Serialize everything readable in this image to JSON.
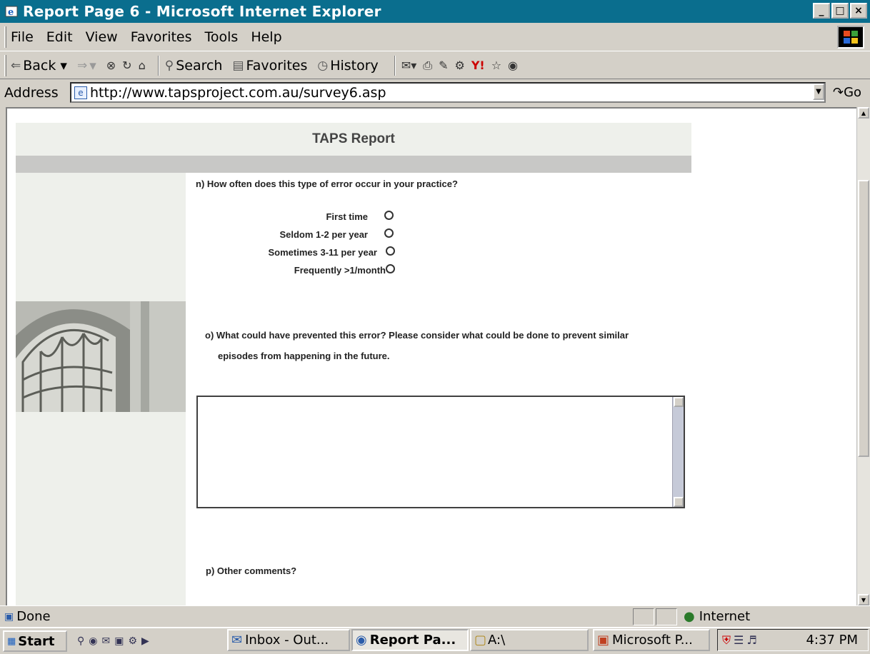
{
  "window": {
    "title": "Report Page 6 - Microsoft Internet Explorer"
  },
  "menu": {
    "items": [
      "File",
      "Edit",
      "View",
      "Favorites",
      "Tools",
      "Help"
    ]
  },
  "toolbar": {
    "back": "Back",
    "search": "Search",
    "favorites": "Favorites",
    "history": "History"
  },
  "address": {
    "label": "Address",
    "url": "http://www.tapsproject.com.au/survey6.asp",
    "go": "Go"
  },
  "page": {
    "header": "TAPS Report",
    "q_n": "n) How often does this type of error occur in your practice?",
    "options": [
      "First time",
      "Seldom 1-2 per year",
      "Sometimes 3-11 per year",
      "Frequently >1/month"
    ],
    "q_o_line1": "o) What could have prevented this error? Please consider what could be done to prevent similar",
    "q_o_line2": "episodes from happening in the future.",
    "q_p": "p) Other comments?"
  },
  "status": {
    "text": "Done",
    "zone": "Internet"
  },
  "taskbar": {
    "start": "Start",
    "tasks": [
      "Inbox - Out...",
      "Report Pa...",
      "A:\\",
      "Microsoft P..."
    ],
    "clock": "4:37 PM"
  }
}
